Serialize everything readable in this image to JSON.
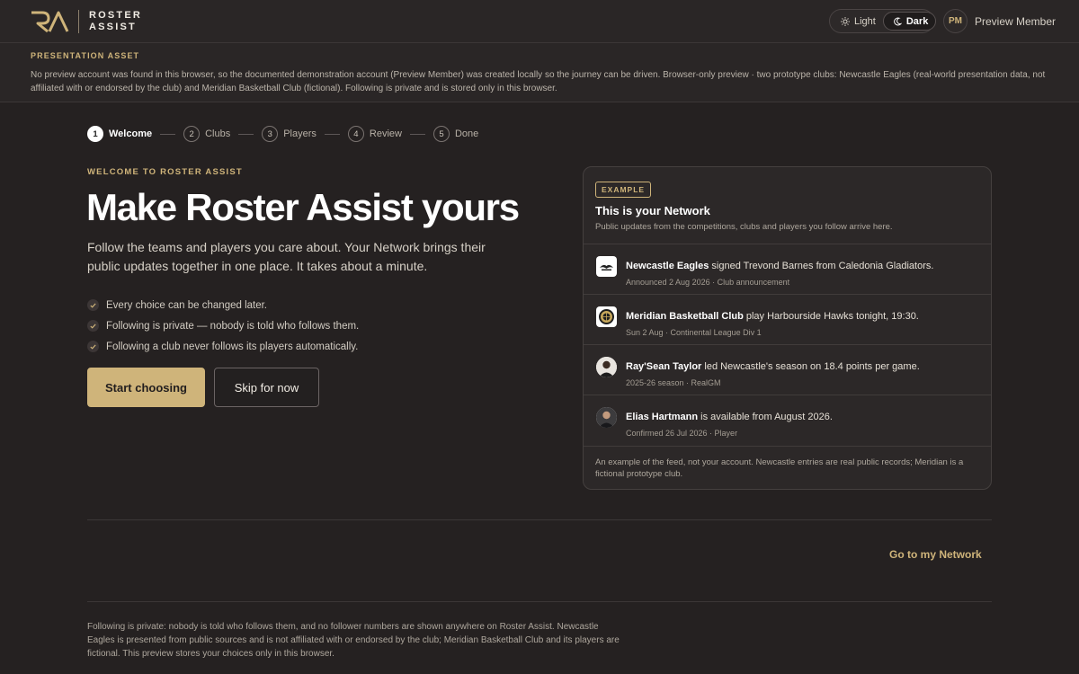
{
  "header": {
    "brand": {
      "line1": "ROSTER",
      "line2": "ASSIST"
    },
    "theme": {
      "light_label": "Light",
      "dark_label": "Dark",
      "selected": "Dark"
    },
    "user": {
      "initials": "PM",
      "name": "Preview Member"
    }
  },
  "notice": {
    "title": "PRESENTATION ASSET",
    "text": "No preview account was found in this browser, so the documented demonstration account (Preview Member) was created locally so the journey can be driven. Browser-only preview · two prototype clubs: Newcastle Eagles (real-world presentation data, not affiliated with or endorsed by the club) and Meridian Basketball Club (fictional). Following is private and is stored only in this browser."
  },
  "stepper": {
    "current": 1,
    "steps": [
      {
        "num": "1",
        "label": "Welcome"
      },
      {
        "num": "2",
        "label": "Clubs"
      },
      {
        "num": "3",
        "label": "Players"
      },
      {
        "num": "4",
        "label": "Review"
      },
      {
        "num": "5",
        "label": "Done"
      }
    ]
  },
  "hero": {
    "eyebrow": "WELCOME TO ROSTER ASSIST",
    "title": "Make Roster Assist yours",
    "subtitle": "Follow the teams and players you care about. Your Network brings their public updates together in one place. It takes about a minute.",
    "checklist": [
      "Every choice can be changed later.",
      "Following is private — nobody is told who follows them.",
      "Following a club never follows its players automatically."
    ],
    "primary_button": "Start choosing",
    "secondary_button": "Skip for now"
  },
  "example_card": {
    "badge": "EXAMPLE",
    "title": "This is your Network",
    "subtitle": "Public updates from the competitions, clubs and players you follow arrive here.",
    "items": [
      {
        "subject": "Newcastle Eagles",
        "text": " signed Trevond Barnes from Caledonia Gladiators.",
        "meta": "Announced 2 Aug 2026 · Club announcement",
        "icon": "eagles-logo-icon"
      },
      {
        "subject": "Meridian Basketball Club",
        "text": " play Harbourside Hawks tonight, 19:30.",
        "meta": "Sun 2 Aug · Continental League Div 1",
        "icon": "meridian-crest-icon"
      },
      {
        "subject": "Ray'Sean Taylor",
        "text": " led Newcastle's season on 18.4 points per game.",
        "meta": "2025-26 season · RealGM",
        "icon": "player-photo-icon"
      },
      {
        "subject": "Elias Hartmann",
        "text": " is available from August 2026.",
        "meta": "Confirmed 26 Jul 2026 · Player",
        "icon": "player-photo-icon"
      }
    ],
    "footnote": "An example of the feed, not your account. Newcastle entries are real public records; Meridian is a fictional prototype club."
  },
  "network_link": "Go to my Network",
  "footer": {
    "text": "Following is private: nobody is told who follows them, and no follower numbers are shown anywhere on Roster Assist. Newcastle Eagles is presented from public sources and is not affiliated with or endorsed by the club; Meridian Basketball Club and its players are fictional. This preview stores your choices only in this browser."
  },
  "colors": {
    "background": "#252121",
    "accent_gold": "#cfb47a",
    "text_primary": "#ffffff"
  }
}
